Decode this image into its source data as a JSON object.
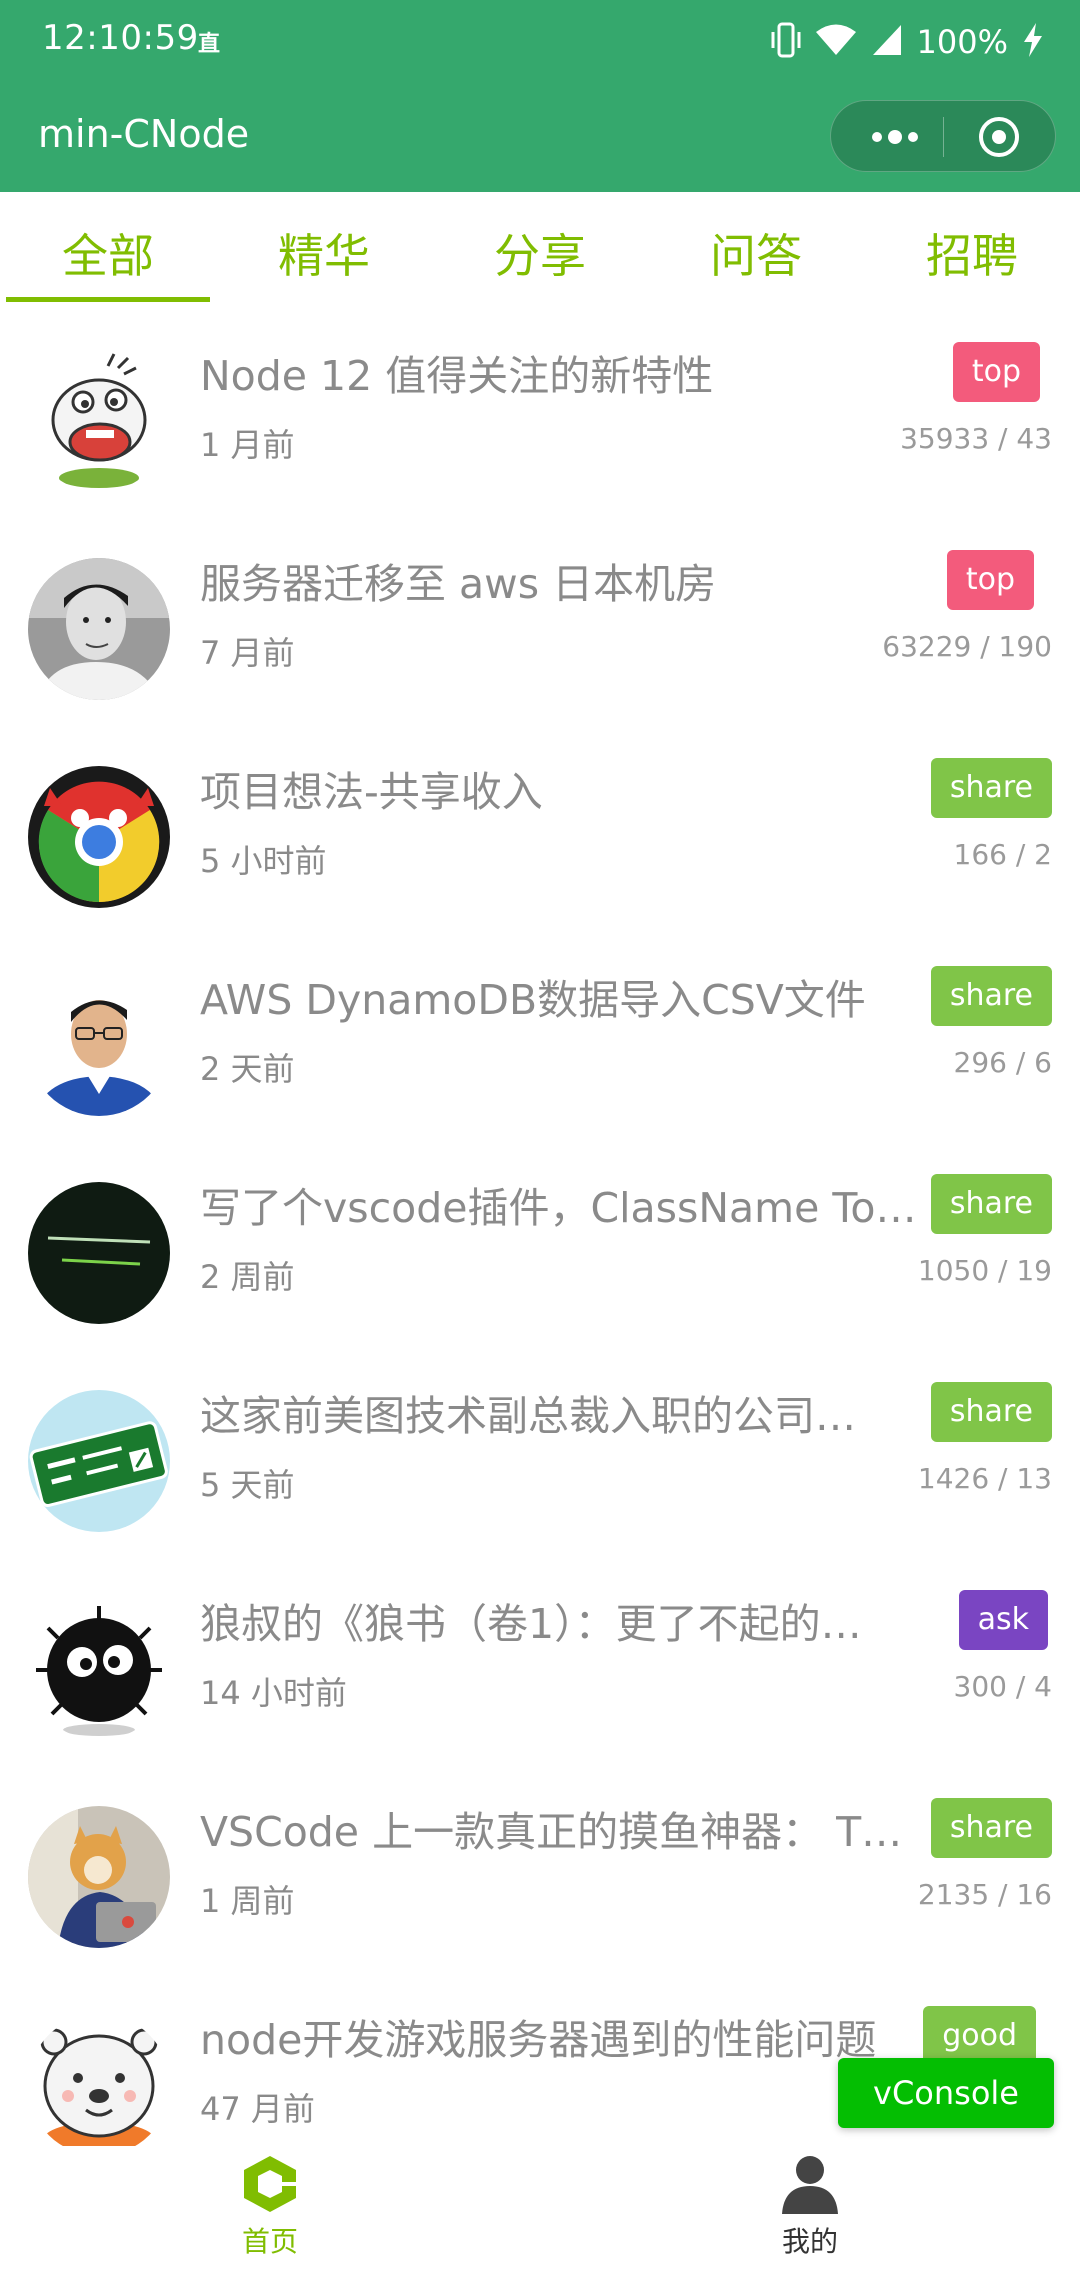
{
  "status_bar": {
    "time": "12:10:59",
    "indicator": "直",
    "battery": "100%",
    "icons": [
      "vibrate-icon",
      "wifi-icon",
      "signal-icon",
      "charging-icon"
    ]
  },
  "nav": {
    "title": "min-CNode",
    "icons": [
      "more-icon",
      "close-mini-program-icon"
    ]
  },
  "tabs": [
    {
      "label": "全部",
      "active": true
    },
    {
      "label": "精华",
      "active": false
    },
    {
      "label": "分享",
      "active": false
    },
    {
      "label": "问答",
      "active": false
    },
    {
      "label": "招聘",
      "active": false
    }
  ],
  "topics": [
    {
      "title": "Node 12 值得关注的新特性",
      "time": "1 月前",
      "tag": "top",
      "stats": "35933 / 43",
      "avatar": "cartoon-dog"
    },
    {
      "title": "服务器迁移至 aws 日本机房",
      "time": "7 月前",
      "tag": "top",
      "stats": "63229 / 190",
      "avatar": "grayscale-portrait"
    },
    {
      "title": "项目想法-共享收入",
      "time": "5 小时前",
      "tag": "share",
      "stats": "166 / 2",
      "avatar": "chrome-devil"
    },
    {
      "title": "AWS DynamoDB数据导入CSV文件",
      "time": "2 天前",
      "tag": "share",
      "stats": "296 / 6",
      "avatar": "man-with-glasses"
    },
    {
      "title": "写了个vscode插件，ClassName To…",
      "time": "2 周前",
      "tag": "share",
      "stats": "1050 / 19",
      "avatar": "dont-be-the-same"
    },
    {
      "title": "这家前美图技术副总裁入职的公司…",
      "time": "5 天前",
      "tag": "share",
      "stats": "1426 / 13",
      "avatar": "newjob-sign"
    },
    {
      "title": "狼叔的《狼书（卷1）：更了不起的…",
      "time": "14 小时前",
      "tag": "ask",
      "stats": "300 / 4",
      "avatar": "soot-sprite"
    },
    {
      "title": "VSCode 上一款真正的摸鱼神器： T…",
      "time": "1 周前",
      "tag": "share",
      "stats": "2135 / 16",
      "avatar": "shiba-laptop"
    },
    {
      "title": "node开发游戏服务器遇到的性能问题",
      "time": "47 月前",
      "tag": "good",
      "stats": "",
      "avatar": "white-bear"
    }
  ],
  "vconsole": "vConsole",
  "tabbar": {
    "home_label": "首页",
    "me_label": "我的"
  },
  "colors": {
    "primary_green": "#35a86d",
    "accent": "#80bd01",
    "tag_top": "#f35b7c",
    "tag_share": "#80c548",
    "tag_ask": "#7a45c2",
    "vconsole": "#04be02"
  }
}
